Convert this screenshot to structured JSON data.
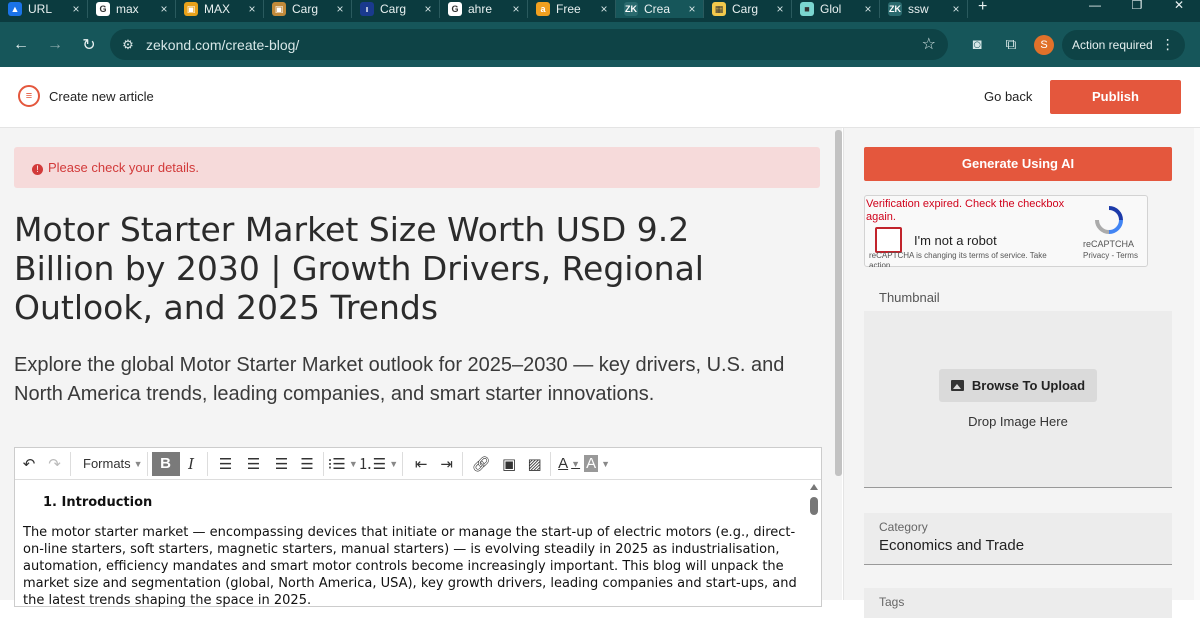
{
  "browser": {
    "tabs": [
      {
        "title": "URL",
        "icon": "translate-icon",
        "color": "#1a73e8",
        "glyph": "▲"
      },
      {
        "title": "max",
        "icon": "google-icon",
        "color": "#ffffff",
        "glyph": "G"
      },
      {
        "title": "MAX",
        "icon": "cargo-icon",
        "color": "#e8a21a",
        "glyph": "▣"
      },
      {
        "title": "Carg",
        "icon": "cargo-icon",
        "color": "#c08a3a",
        "glyph": "▣"
      },
      {
        "title": "Carg",
        "icon": "cargo-icon",
        "color": "#1a3a8e",
        "glyph": "ı"
      },
      {
        "title": "ahre",
        "icon": "google-icon",
        "color": "#ffffff",
        "glyph": "G"
      },
      {
        "title": "Free",
        "icon": "amazon-icon",
        "color": "#f0a020",
        "glyph": "a"
      },
      {
        "title": "Crea",
        "icon": "zekond-icon",
        "color": "#2a6a6e",
        "glyph": "ZK",
        "active": true
      },
      {
        "title": "Carg",
        "icon": "cargo-icon",
        "color": "#f2c94c",
        "glyph": "▦"
      },
      {
        "title": "Glol",
        "icon": "globe-icon",
        "color": "#7ad6d0",
        "glyph": "■"
      },
      {
        "title": "ssw",
        "icon": "zekond-icon",
        "color": "#2a6a6e",
        "glyph": "ZK"
      }
    ],
    "new_tab": "+",
    "url": "zekond.com/create-blog/",
    "avatar_letter": "S",
    "action_label": "Action required"
  },
  "header": {
    "title": "Create new article",
    "go_back": "Go back",
    "publish": "Publish"
  },
  "main": {
    "alert": "Please check your details.",
    "headline": "Motor Starter Market Size Worth USD 9.2 Billion by 2030 | Growth Drivers, Regional Outlook, and 2025 Trends",
    "subhead": "Explore the global Motor Starter Market outlook for 2025–2030 — key drivers, U.S. and North America trends, leading companies, and smart starter innovations.",
    "editor": {
      "formats_label": "Formats",
      "heading_number": "1.",
      "heading": "Introduction",
      "paragraph": "The motor starter market — encompassing devices that initiate or manage the start-up of electric motors (e.g., direct-on-line starters, soft starters, magnetic starters, manual starters) — is evolving steadily in 2025 as industrialisation, automation, efficiency mandates and smart motor controls become increasingly important. This blog will unpack the market size and segmentation (global, North America, USA), key growth drivers, leading companies and start-ups, and the latest trends shaping the space in 2025."
    }
  },
  "sidebar": {
    "generate_ai": "Generate Using AI",
    "recaptcha": {
      "expired": "Verification expired. Check the checkbox again.",
      "label": "I'm not a robot",
      "brand": "reCAPTCHA",
      "links": "Privacy - Terms",
      "note": "reCAPTCHA is changing its terms of service. Take action."
    },
    "thumbnail_label": "Thumbnail",
    "browse": "Browse To Upload",
    "drop": "Drop Image Here",
    "category_label": "Category",
    "category_value": "Economics and Trade",
    "tags_label": "Tags"
  },
  "colors": {
    "accent": "#e4573d",
    "browser_chrome": "#16565a",
    "alert_bg": "#f6dada"
  }
}
